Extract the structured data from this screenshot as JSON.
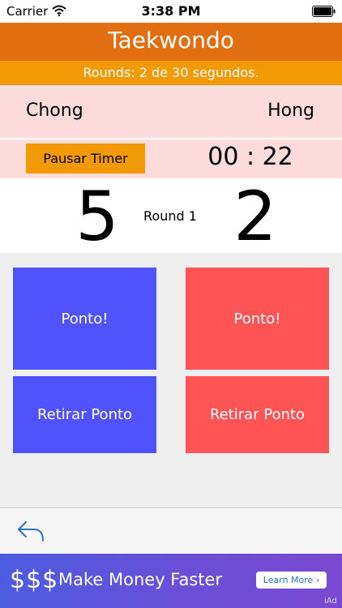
{
  "status_bar": {
    "carrier": "Carrier",
    "time": "3:38 PM",
    "wifi_icon": "wifi-icon",
    "battery_icon": "battery-icon"
  },
  "header": {
    "title": "Taekwondo",
    "rounds_info": "Rounds: 2 de 30 segundos."
  },
  "players": {
    "left_name": "Chong",
    "right_name": "Hong"
  },
  "timer": {
    "pause_label": "Pausar Timer",
    "time": "00 : 22"
  },
  "score": {
    "left": "5",
    "right": "2",
    "round_label": "Round 1"
  },
  "buttons": {
    "left_point": "Ponto!",
    "right_point": "Ponto!",
    "left_remove": "Retirar Ponto",
    "right_remove": "Retirar Ponto"
  },
  "toolbar": {
    "back_icon": "back-arrow-icon"
  },
  "ad": {
    "dollars": "$$$",
    "text": "Make Money Faster",
    "button_label": "Learn More ›",
    "iad": "iAd"
  },
  "colors": {
    "title_bar": "#e16e10",
    "rounds_bar": "#f29a05",
    "pink_bg": "#ffdcdc",
    "blue_button": "#5052fb",
    "red_button": "#ff5455"
  }
}
